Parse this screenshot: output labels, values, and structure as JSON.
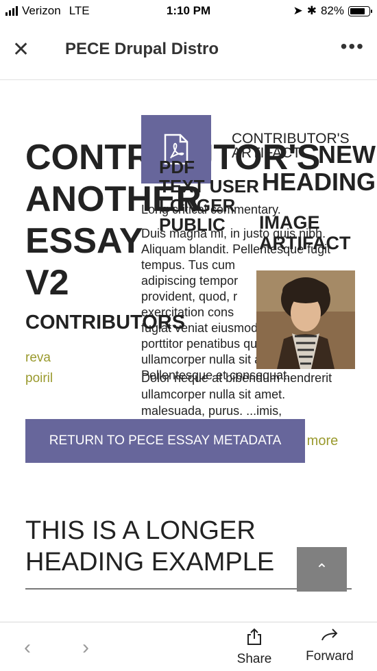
{
  "status_bar": {
    "carrier": "Verizon",
    "network": "LTE",
    "time": "1:10 PM",
    "battery": "82%",
    "battery_level": 0.82
  },
  "app_bar": {
    "title": "PECE Drupal Distro"
  },
  "essay": {
    "title_lines": [
      "CONTRIBUTOR'S",
      "ANOTHER ESSAY",
      "V2"
    ],
    "contributors_heading": "CONTRIBUTORS",
    "contributors": [
      "reva",
      "poiril"
    ],
    "overlap_small": [
      "CONTRIBUTOR'S",
      "ARTIFACT"
    ],
    "overlap_lines": [
      "PDF",
      "TEXT USER",
      "LONGER",
      "PUBLIC",
      "IMAGE"
    ],
    "right_caps": [
      "LONGER",
      "HEADING",
      "ARTIFACT"
    ],
    "mid_right": [
      "NEW",
      "HEADING"
    ],
    "critical_text": "Long critical commentary.",
    "lorem_lines": [
      "Duis magna mi, in justo quis nibh.",
      "Aliquam blandit. Pellentesque fugit",
      "tempus. Tus cum",
      "adipiscing tempor",
      "provident, quod, r",
      "exercitation cons",
      "fugiat veniat eiusmod",
      "porttitor penatibus quis",
      "ullamcorper nulla sit amet.",
      "Pellentesque et consequat."
    ],
    "excerpt_lines": [
      "Dolor neque at bibendum hendrerit",
      "ullamcorper nulla sit amet.",
      "malesuada, purus. ...imis,"
    ],
    "read_more": "d more",
    "return_button": "RETURN TO PECE ESSAY METADATA",
    "long_heading": "THIS IS A LONGER HEADING EXAMPLE"
  },
  "toolbar": {
    "share_label": "Share",
    "forward_label": "Forward"
  },
  "colors": {
    "accent": "#67669b",
    "link": "#9a9a2e",
    "scroll_top": "#808080"
  }
}
